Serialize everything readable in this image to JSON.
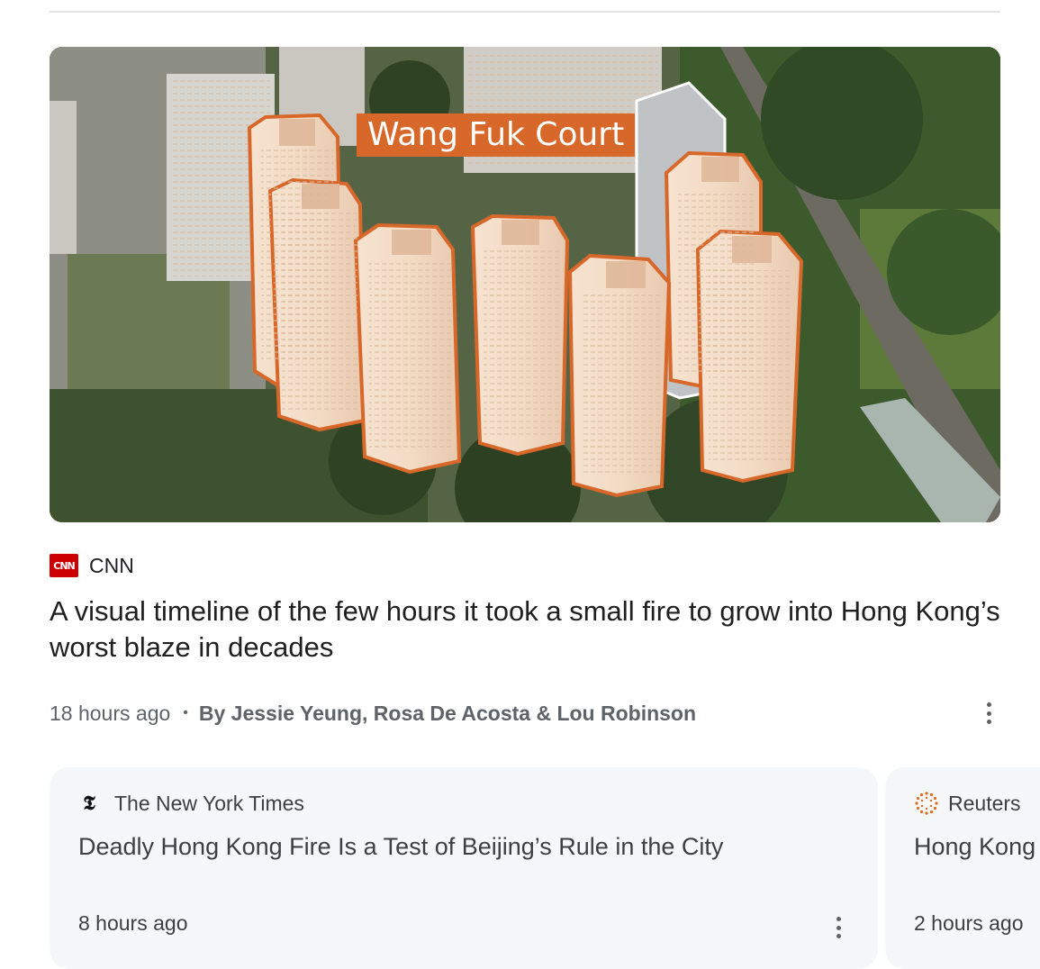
{
  "hero": {
    "overlay_label": "Wang Fuk Court",
    "label_color": "#d8672a",
    "outline_color": "#d8672a"
  },
  "article": {
    "source": {
      "name": "CNN",
      "logo_text": "CNN",
      "logo_color": "#cc0000"
    },
    "headline": "A visual timeline of the few hours it took a small fire to grow into Hong Kong’s worst blaze in decades",
    "time": "18 hours ago",
    "separator": "•",
    "byline": "By Jessie Yeung, Rosa De Acosta & Lou Robinson",
    "menu_icon": "more-vert-icon"
  },
  "related": [
    {
      "source": "The New York Times",
      "source_icon_glyph": "𝕿",
      "title": "Deadly Hong Kong Fire Is a Test of Beijing’s Rule in the City",
      "time": "8 hours ago",
      "menu_icon": "more-vert-icon"
    },
    {
      "source": "Reuters",
      "source_icon": "reuters-logo-icon",
      "title": "Hong Kong",
      "time": "2 hours ago"
    }
  ]
}
